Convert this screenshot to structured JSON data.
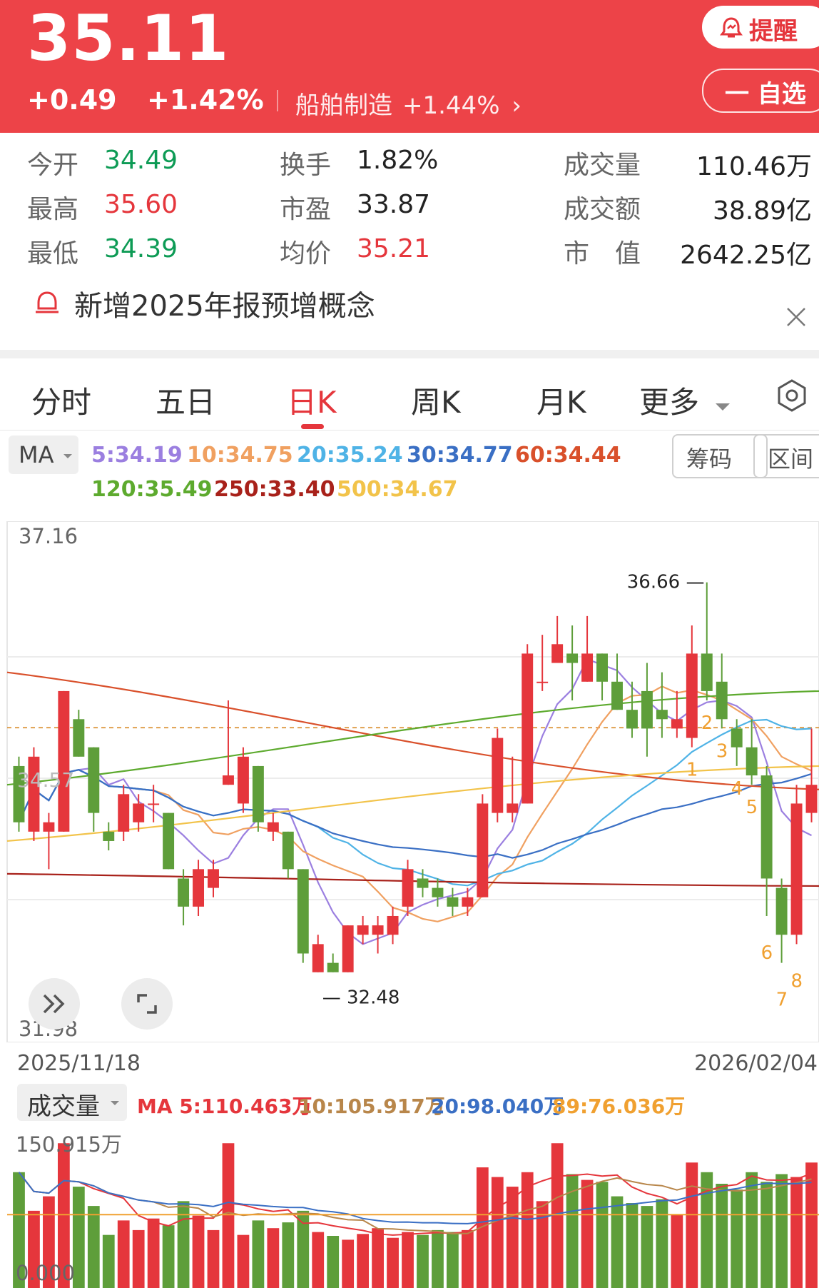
{
  "header": {
    "price": "35.11",
    "change": "+0.49",
    "change_pct": "+1.42%",
    "sector_name": "船舶制造",
    "sector_pct": "+1.44%",
    "alarm_label": "提醒",
    "fav_label": "一 自选"
  },
  "stats": {
    "open_label": "今开",
    "open": "34.49",
    "high_label": "最高",
    "high": "35.60",
    "low_label": "最低",
    "low": "34.39",
    "turnover_label": "换手",
    "turnover": "1.82%",
    "pe_label": "市盈",
    "pe": "33.87",
    "avg_label": "均价",
    "avg": "35.21",
    "volume_label": "成交量",
    "volume": "110.46万",
    "amount_label": "成交额",
    "amount": "38.89亿",
    "mcap_label": "市　值",
    "mcap": "2642.25亿"
  },
  "notice": {
    "text": "新增2025年报预增概念"
  },
  "tabs": [
    "分时",
    "五日",
    "日K",
    "周K",
    "月K",
    "更多"
  ],
  "active_tab": "日K",
  "ma_bar": {
    "select_label": "MA",
    "items": [
      {
        "text": "5:34.19",
        "color": "#9b7fe0"
      },
      {
        "text": "10:34.75",
        "color": "#f0a060"
      },
      {
        "text": "20:35.24",
        "color": "#4fb3e6"
      },
      {
        "text": "30:34.77",
        "color": "#3a6fc4"
      },
      {
        "text": "60:34.44",
        "color": "#d9502b"
      },
      {
        "text": "120:35.49",
        "color": "#5daa2e"
      },
      {
        "text": "250:33.40",
        "color": "#a8211a"
      },
      {
        "text": "500:34.67",
        "color": "#f2c34a"
      }
    ],
    "chips_btn": "筹码",
    "range_btn": "区间"
  },
  "kline": {
    "y_max_label": "37.16",
    "y_min_label": "31.98",
    "y_mid_label": "34.57",
    "high_mark": "36.66",
    "low_mark": "32.48",
    "start_date": "2025/11/18",
    "end_date": "2026/02/04",
    "markers": [
      "1",
      "2",
      "3",
      "4",
      "5",
      "6",
      "7",
      "8"
    ]
  },
  "volume": {
    "select_label": "成交量",
    "ma_items": [
      {
        "text": "MA 5:110.463万",
        "color": "#e5363c"
      },
      {
        "text": "10:105.917万",
        "color": "#b8864a"
      },
      {
        "text": "20:98.040万",
        "color": "#3a6fc4"
      },
      {
        "text": "89:76.036万",
        "color": "#f0a030"
      }
    ],
    "y_max_label": "150.915万",
    "y_min_label": "0.000"
  },
  "colors": {
    "up": "#e5363c",
    "down": "#5e9e3a",
    "header_bg": "#ed4348"
  },
  "chart_data": {
    "type": "candlestick",
    "x_range": [
      "2025/11/18",
      "2026/02/04"
    ],
    "ylim": [
      31.98,
      37.16
    ],
    "candles": [
      {
        "o": 34.7,
        "c": 34.1,
        "h": 34.8,
        "l": 34.0
      },
      {
        "o": 34.0,
        "c": 34.8,
        "h": 34.9,
        "l": 33.9
      },
      {
        "o": 34.0,
        "c": 34.1,
        "h": 34.2,
        "l": 33.6
      },
      {
        "o": 34.0,
        "c": 35.5,
        "h": 35.5,
        "l": 34.0
      },
      {
        "o": 35.2,
        "c": 34.8,
        "h": 35.3,
        "l": 34.8
      },
      {
        "o": 34.9,
        "c": 34.2,
        "h": 34.9,
        "l": 34.0
      },
      {
        "o": 34.0,
        "c": 33.9,
        "h": 34.1,
        "l": 33.8
      },
      {
        "o": 34.0,
        "c": 34.4,
        "h": 34.5,
        "l": 33.9
      },
      {
        "o": 34.1,
        "c": 34.3,
        "h": 34.4,
        "l": 34.0
      },
      {
        "o": 34.3,
        "c": 34.3,
        "h": 34.5,
        "l": 34.1
      },
      {
        "o": 34.2,
        "c": 33.6,
        "h": 34.2,
        "l": 33.6
      },
      {
        "o": 33.5,
        "c": 33.2,
        "h": 33.6,
        "l": 33.0
      },
      {
        "o": 33.2,
        "c": 33.6,
        "h": 33.7,
        "l": 33.1
      },
      {
        "o": 33.4,
        "c": 33.6,
        "h": 33.7,
        "l": 33.3
      },
      {
        "o": 34.5,
        "c": 34.6,
        "h": 35.4,
        "l": 34.5
      },
      {
        "o": 34.3,
        "c": 34.8,
        "h": 34.9,
        "l": 34.2
      },
      {
        "o": 34.7,
        "c": 34.1,
        "h": 34.7,
        "l": 34.0
      },
      {
        "o": 34.0,
        "c": 34.1,
        "h": 34.2,
        "l": 33.9
      },
      {
        "o": 34.0,
        "c": 33.6,
        "h": 34.0,
        "l": 33.5
      },
      {
        "o": 33.6,
        "c": 32.7,
        "h": 33.6,
        "l": 32.6
      },
      {
        "o": 32.5,
        "c": 32.8,
        "h": 32.9,
        "l": 32.5
      },
      {
        "o": 32.6,
        "c": 32.5,
        "h": 32.7,
        "l": 32.5
      },
      {
        "o": 32.5,
        "c": 33.0,
        "h": 33.0,
        "l": 32.5
      },
      {
        "o": 32.9,
        "c": 33.0,
        "h": 33.1,
        "l": 32.8
      },
      {
        "o": 32.9,
        "c": 33.0,
        "h": 33.1,
        "l": 32.7
      },
      {
        "o": 32.9,
        "c": 33.1,
        "h": 33.2,
        "l": 32.8
      },
      {
        "o": 33.2,
        "c": 33.6,
        "h": 33.7,
        "l": 33.1
      },
      {
        "o": 33.5,
        "c": 33.4,
        "h": 33.6,
        "l": 33.3
      },
      {
        "o": 33.4,
        "c": 33.3,
        "h": 33.5,
        "l": 33.2
      },
      {
        "o": 33.3,
        "c": 33.2,
        "h": 33.4,
        "l": 33.1
      },
      {
        "o": 33.2,
        "c": 33.3,
        "h": 33.4,
        "l": 33.1
      },
      {
        "o": 33.3,
        "c": 34.3,
        "h": 34.4,
        "l": 33.3
      },
      {
        "o": 34.2,
        "c": 35.0,
        "h": 35.1,
        "l": 34.1
      },
      {
        "o": 34.2,
        "c": 34.3,
        "h": 34.8,
        "l": 34.1
      },
      {
        "o": 34.3,
        "c": 35.9,
        "h": 36.0,
        "l": 34.3
      },
      {
        "o": 35.6,
        "c": 35.6,
        "h": 36.1,
        "l": 35.5
      },
      {
        "o": 35.8,
        "c": 36.0,
        "h": 36.3,
        "l": 35.8
      },
      {
        "o": 35.9,
        "c": 35.8,
        "h": 36.2,
        "l": 35.4
      },
      {
        "o": 35.6,
        "c": 35.9,
        "h": 36.3,
        "l": 35.6
      },
      {
        "o": 35.9,
        "c": 35.6,
        "h": 35.9,
        "l": 35.4
      },
      {
        "o": 35.6,
        "c": 35.3,
        "h": 35.9,
        "l": 35.3
      },
      {
        "o": 35.3,
        "c": 35.1,
        "h": 35.6,
        "l": 35.0
      },
      {
        "o": 35.5,
        "c": 35.1,
        "h": 35.8,
        "l": 34.8
      },
      {
        "o": 35.3,
        "c": 35.2,
        "h": 35.7,
        "l": 35.0
      },
      {
        "o": 35.1,
        "c": 35.2,
        "h": 35.5,
        "l": 35.0
      },
      {
        "o": 35.0,
        "c": 35.9,
        "h": 36.2,
        "l": 34.9
      },
      {
        "o": 35.9,
        "c": 35.5,
        "h": 36.66,
        "l": 35.4
      },
      {
        "o": 35.6,
        "c": 35.2,
        "h": 35.9,
        "l": 35.1
      },
      {
        "o": 35.1,
        "c": 34.9,
        "h": 35.2,
        "l": 34.7
      },
      {
        "o": 34.9,
        "c": 34.6,
        "h": 35.2,
        "l": 34.5
      },
      {
        "o": 34.6,
        "c": 33.5,
        "h": 34.7,
        "l": 33.1
      },
      {
        "o": 33.4,
        "c": 32.9,
        "h": 33.5,
        "l": 32.6
      },
      {
        "o": 32.9,
        "c": 34.3,
        "h": 34.5,
        "l": 32.8
      },
      {
        "o": 34.2,
        "c": 34.5,
        "h": 35.1,
        "l": 34.1
      }
    ],
    "volume_ylim": [
      0,
      150.915
    ],
    "volume_unit": "万"
  }
}
